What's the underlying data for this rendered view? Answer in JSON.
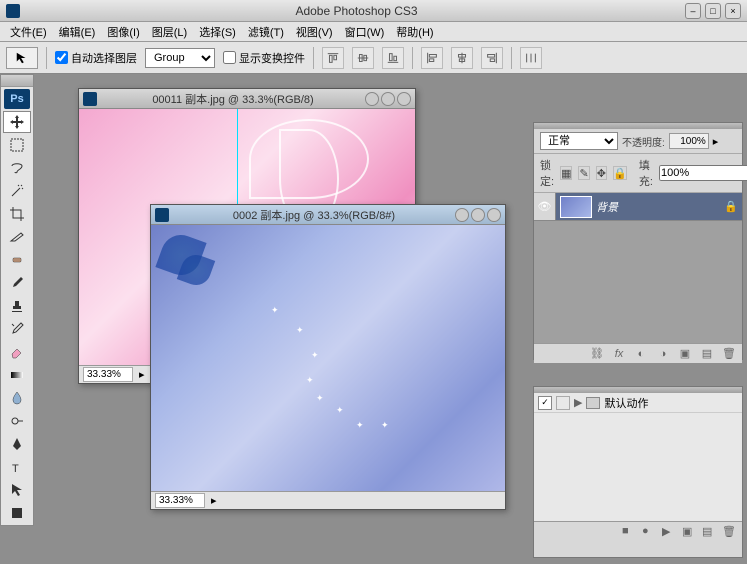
{
  "app": {
    "title": "Adobe Photoshop CS3",
    "logo": "Ps"
  },
  "menu": [
    "文件(E)",
    "编辑(E)",
    "图像(I)",
    "图层(L)",
    "选择(S)",
    "滤镜(T)",
    "视图(V)",
    "窗口(W)",
    "帮助(H)"
  ],
  "options": {
    "auto_select_label": "自动选择图层",
    "auto_select_checked": true,
    "group_select": "Group",
    "show_transform_label": "显示变换控件",
    "show_transform_checked": false
  },
  "documents": [
    {
      "title": "00011 副本.jpg @ 33.3%(RGB/8)",
      "zoom": "33.33%",
      "active": false
    },
    {
      "title": "0002 副本.jpg @ 33.3%(RGB/8#)",
      "zoom": "33.33%",
      "active": true
    }
  ],
  "layers": {
    "blend_mode": "正常",
    "opacity_label": "不透明度:",
    "opacity_value": "100%",
    "lock_label": "锁定:",
    "fill_label": "填充:",
    "fill_value": "100%",
    "items": [
      {
        "name": "背景",
        "visible": true,
        "locked": true
      }
    ]
  },
  "actions": {
    "default_set": "默认动作"
  }
}
